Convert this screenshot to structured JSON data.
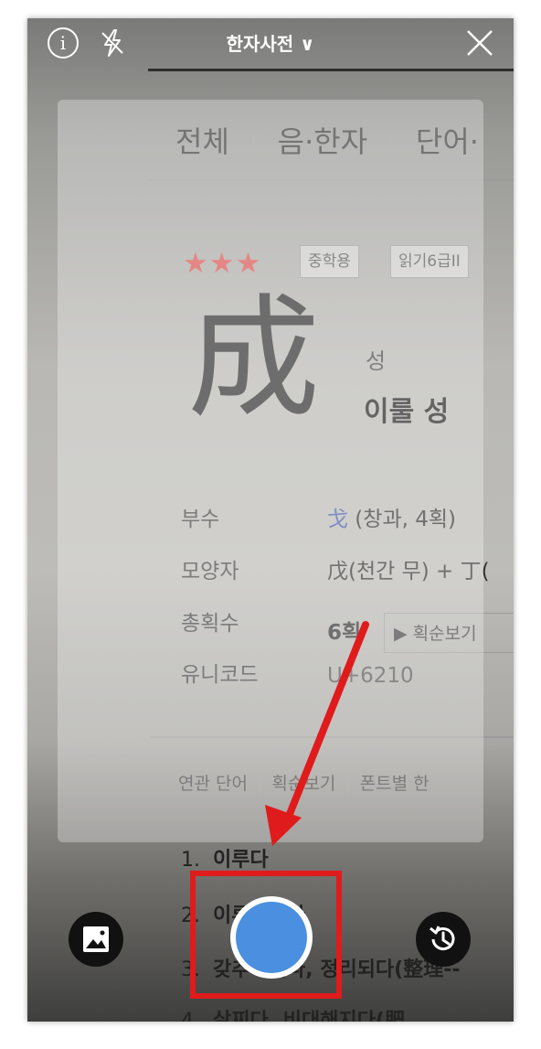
{
  "app": {
    "title": "한자사전 ∨"
  },
  "top_bar": {
    "info_icon": "info-icon",
    "flash_icon": "flash-off-icon",
    "close_icon": "close-icon"
  },
  "camera_view": {
    "tabs": [
      "전체",
      "음·한자",
      "단어·"
    ],
    "stars": "★★★",
    "tags": [
      "중학용",
      "읽기6급II"
    ],
    "hanja": "成",
    "reading": "성",
    "meaning": "이룰 성",
    "info": [
      {
        "label": "부수",
        "value_radical": "戈",
        "value": " (창과, 4획)"
      },
      {
        "label": "모양자",
        "value": "戊(천간 무) + 丁("
      },
      {
        "label": "총획수",
        "value": "6획"
      },
      {
        "label": "유니코드",
        "value": "U+6210"
      }
    ],
    "stroke_button": "▶ 획순보기",
    "links": [
      "연관 단어",
      "획순보기",
      "폰트별 한"
    ],
    "definitions": [
      {
        "num": "1.",
        "text": "이루다"
      },
      {
        "num": "2.",
        "text": "이루어지다"
      },
      {
        "num": "3.",
        "text": "갖추어지다, 정리되다(整理--"
      },
      {
        "num": "4.",
        "text": "살찌다, 비대해지다(肥"
      }
    ]
  },
  "controls": {
    "gallery_icon": "image-icon",
    "history_icon": "history-icon",
    "shutter_color": "#4a8fe0"
  },
  "annotation": {
    "color": "#e01b1b"
  }
}
